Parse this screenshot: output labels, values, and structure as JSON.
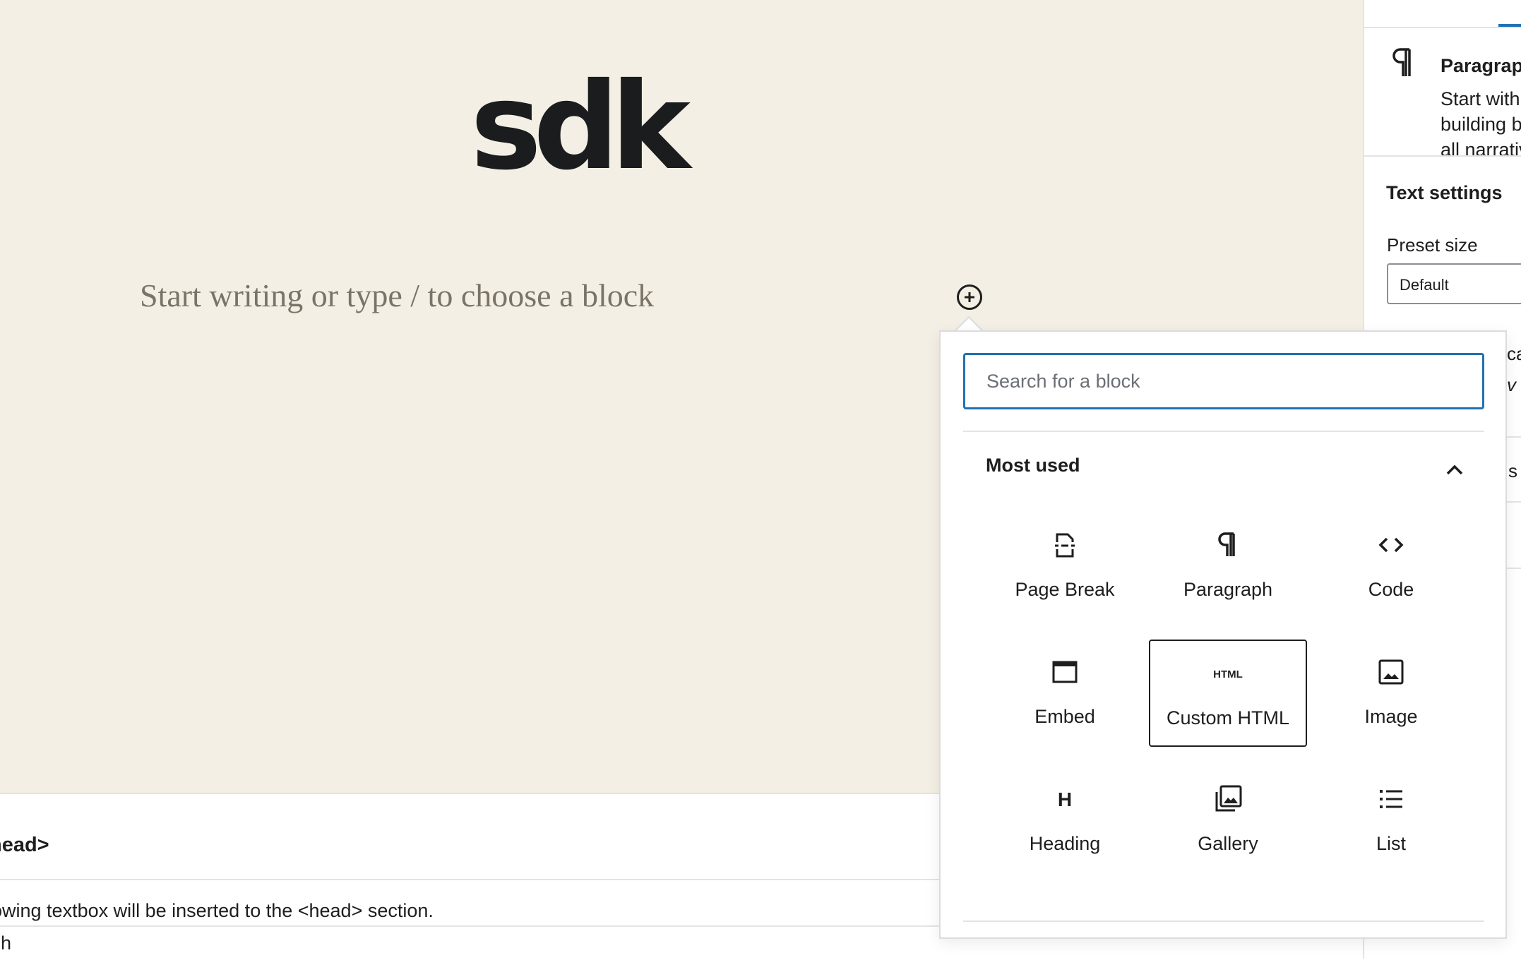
{
  "canvas": {
    "site_title": "sdk",
    "placeholder": "Start writing or type / to choose a block",
    "background": "#f4efe4"
  },
  "inserter": {
    "search_placeholder": "Search for a block",
    "section_title": "Most used",
    "blocks": [
      {
        "label": "Page Break",
        "icon": "page-break-icon"
      },
      {
        "label": "Paragraph",
        "icon": "paragraph-icon"
      },
      {
        "label": "Code",
        "icon": "code-icon"
      },
      {
        "label": "Embed",
        "icon": "embed-icon"
      },
      {
        "label": "Custom HTML",
        "icon": "html-icon",
        "selected": true,
        "icon_text": "HTML"
      },
      {
        "label": "Image",
        "icon": "image-icon"
      },
      {
        "label": "Heading",
        "icon": "heading-icon",
        "icon_text": "H"
      },
      {
        "label": "Gallery",
        "icon": "gallery-icon"
      },
      {
        "label": "List",
        "icon": "list-icon"
      }
    ]
  },
  "sidebar": {
    "block_name": "Paragraph",
    "block_desc": "Start with the building block of all narrative.",
    "text_settings": "Text settings",
    "preset_label": "Preset size",
    "preset_value": "Default",
    "partial_1": "ca",
    "partial_2": "v a",
    "partial_3": "s"
  },
  "meta_box": {
    "title": "head>",
    "description": "owing textbox will be inserted to the <head> section.",
    "breadcrumb": "ph"
  },
  "colors": {
    "accent": "#2271b1",
    "text": "#1e1e1e"
  }
}
